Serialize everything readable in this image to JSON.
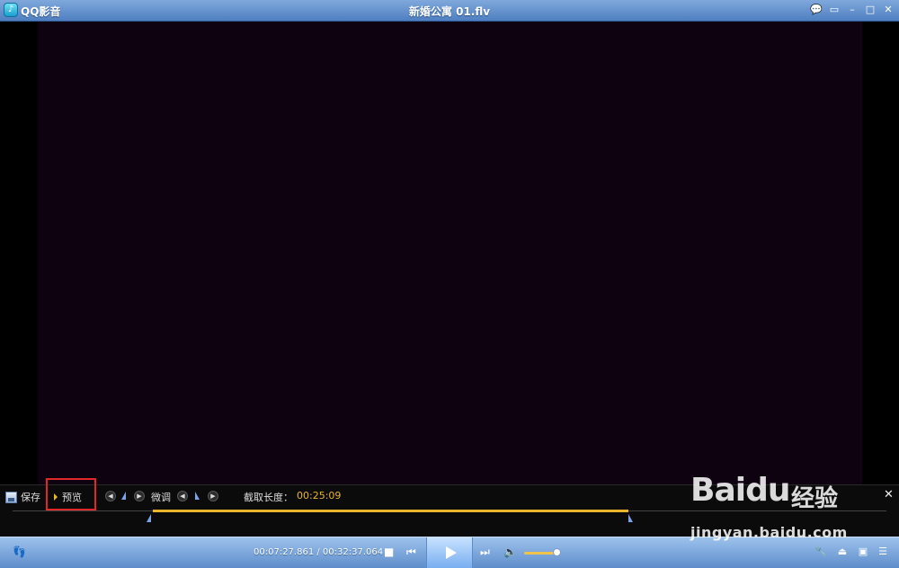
{
  "titlebar": {
    "app_name": "QQ影音",
    "window_title": "新婚公寓 01.flv",
    "buttons": [
      "speech-bubble-icon",
      "menu-icon",
      "minimize-icon",
      "maximize-icon",
      "close-icon"
    ]
  },
  "edit_bar": {
    "save_label": "保存",
    "preview_label": "预览",
    "fine_tune_label": "微调",
    "length_label": "截取长度：",
    "length_value": "00:25:09",
    "close_symbol": "✕"
  },
  "controls": {
    "time_display": "00:07:27.861 / 00:32:37.064",
    "volume_level": 0.9
  },
  "watermark": {
    "logo_a": "Bai",
    "logo_b": "du",
    "jingyan": "经验",
    "url": "jingyan.baidu.com"
  },
  "colors": {
    "accent": "#e9b52b",
    "marker": "#7aa3e8",
    "highlight": "#e02828",
    "video_bg": "#0f0210"
  }
}
